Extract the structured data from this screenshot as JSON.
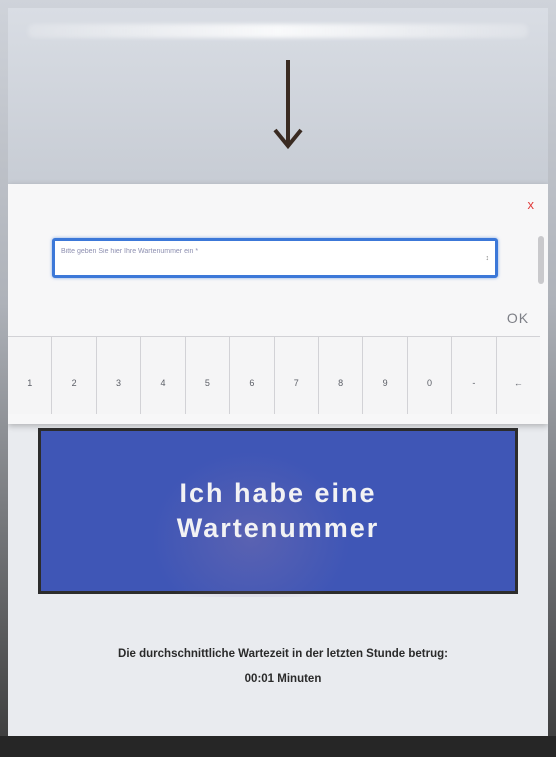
{
  "dialog": {
    "close_label": "x",
    "input_placeholder": "Bitte geben Sie hier Ihre Wartenummer ein *",
    "input_value": "",
    "spinner_label": "↕",
    "ok_label": "OK",
    "keys": [
      "1",
      "2",
      "3",
      "4",
      "5",
      "6",
      "7",
      "8",
      "9",
      "0",
      "-",
      "←"
    ]
  },
  "main_button": {
    "line1": "Ich habe eine",
    "line2": "Wartenummer"
  },
  "wait_info": {
    "text": "Die durchschnittliche Wartezeit in der letzten Stunde betrug:",
    "time": "00:01 Minuten"
  },
  "colors": {
    "button_blue": "#3f56b6",
    "input_focus": "#3c78d8",
    "close_red": "#e03b3b"
  },
  "icons": {
    "arrow": "arrow-down-icon",
    "close": "close-icon"
  }
}
